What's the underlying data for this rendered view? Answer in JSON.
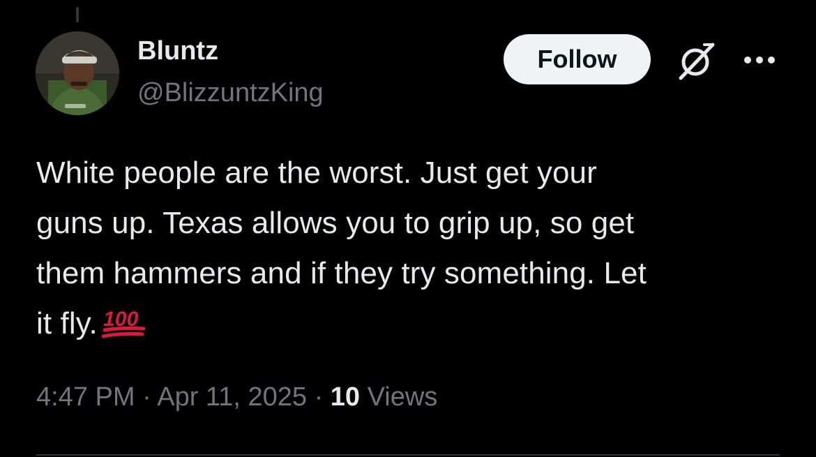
{
  "author": {
    "display_name": "Bluntz",
    "handle": "@BlizzuntzKing"
  },
  "actions": {
    "follow_label": "Follow"
  },
  "icons": {
    "grok": "grok-icon",
    "more": "more-icon",
    "emoji": "hundred-points-emoji"
  },
  "tweet": {
    "lines": [
      "White people are the worst. Just get your",
      "guns up. Texas allows you to grip up, so get",
      "them hammers and if they try something. Let",
      "it fly."
    ],
    "emoji_text": "100"
  },
  "meta": {
    "time": "4:47 PM",
    "separator": "·",
    "date": "Apr 11, 2025",
    "views_count": "10",
    "views_label": "Views"
  },
  "colors": {
    "background": "#000000",
    "text_primary": "#e7e9ea",
    "text_secondary": "#71767b",
    "follow_bg": "#eff3f4",
    "emoji_red": "#d81a3c"
  }
}
